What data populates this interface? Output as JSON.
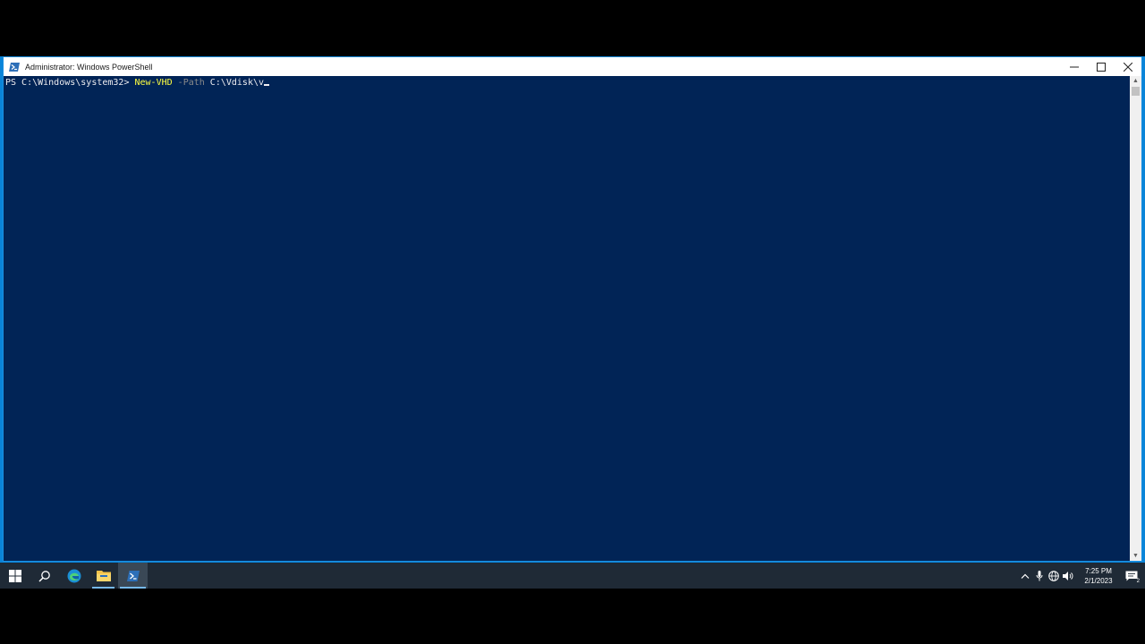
{
  "window": {
    "title": "Administrator: Windows PowerShell"
  },
  "console": {
    "prompt": "PS C:\\Windows\\system32> ",
    "command": "New-VHD",
    "parameter": " -Path",
    "argument": " C:\\Vdisk\\v"
  },
  "taskbar": {
    "apps": [
      {
        "name": "start",
        "icon": "windows-logo-icon"
      },
      {
        "name": "search",
        "icon": "search-icon"
      },
      {
        "name": "edge",
        "icon": "edge-icon"
      },
      {
        "name": "file-explorer",
        "icon": "folder-icon"
      },
      {
        "name": "powershell",
        "icon": "powershell-icon"
      }
    ],
    "clock": {
      "time": "7:25 PM",
      "date": "2/1/2023"
    },
    "notification_count": "2"
  },
  "colors": {
    "console_bg": "#012456",
    "command": "#fefe40",
    "parameter": "#8a8a8a",
    "text": "#eeedf0",
    "taskbar": "#1f2a36",
    "accent": "#0a84d8"
  }
}
